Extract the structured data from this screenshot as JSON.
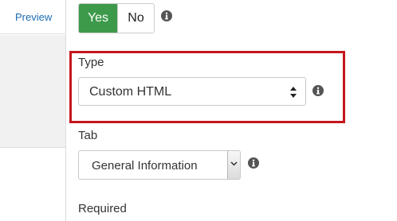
{
  "left_panel": {
    "tab_link": "Preview"
  },
  "toggle": {
    "yes_label": "Yes",
    "no_label": "No",
    "selected": "Yes"
  },
  "type_field": {
    "label": "Type",
    "value": "Custom HTML"
  },
  "tab_field": {
    "label": "Tab",
    "value": "General Information"
  },
  "required_field": {
    "label": "Required"
  },
  "colors": {
    "accent_green": "#3e9a4b",
    "highlight_red": "#c4161c",
    "link_blue": "#1b6cb3"
  },
  "icons": [
    "info-icon",
    "select-arrows-icon",
    "chevron-down-icon"
  ]
}
